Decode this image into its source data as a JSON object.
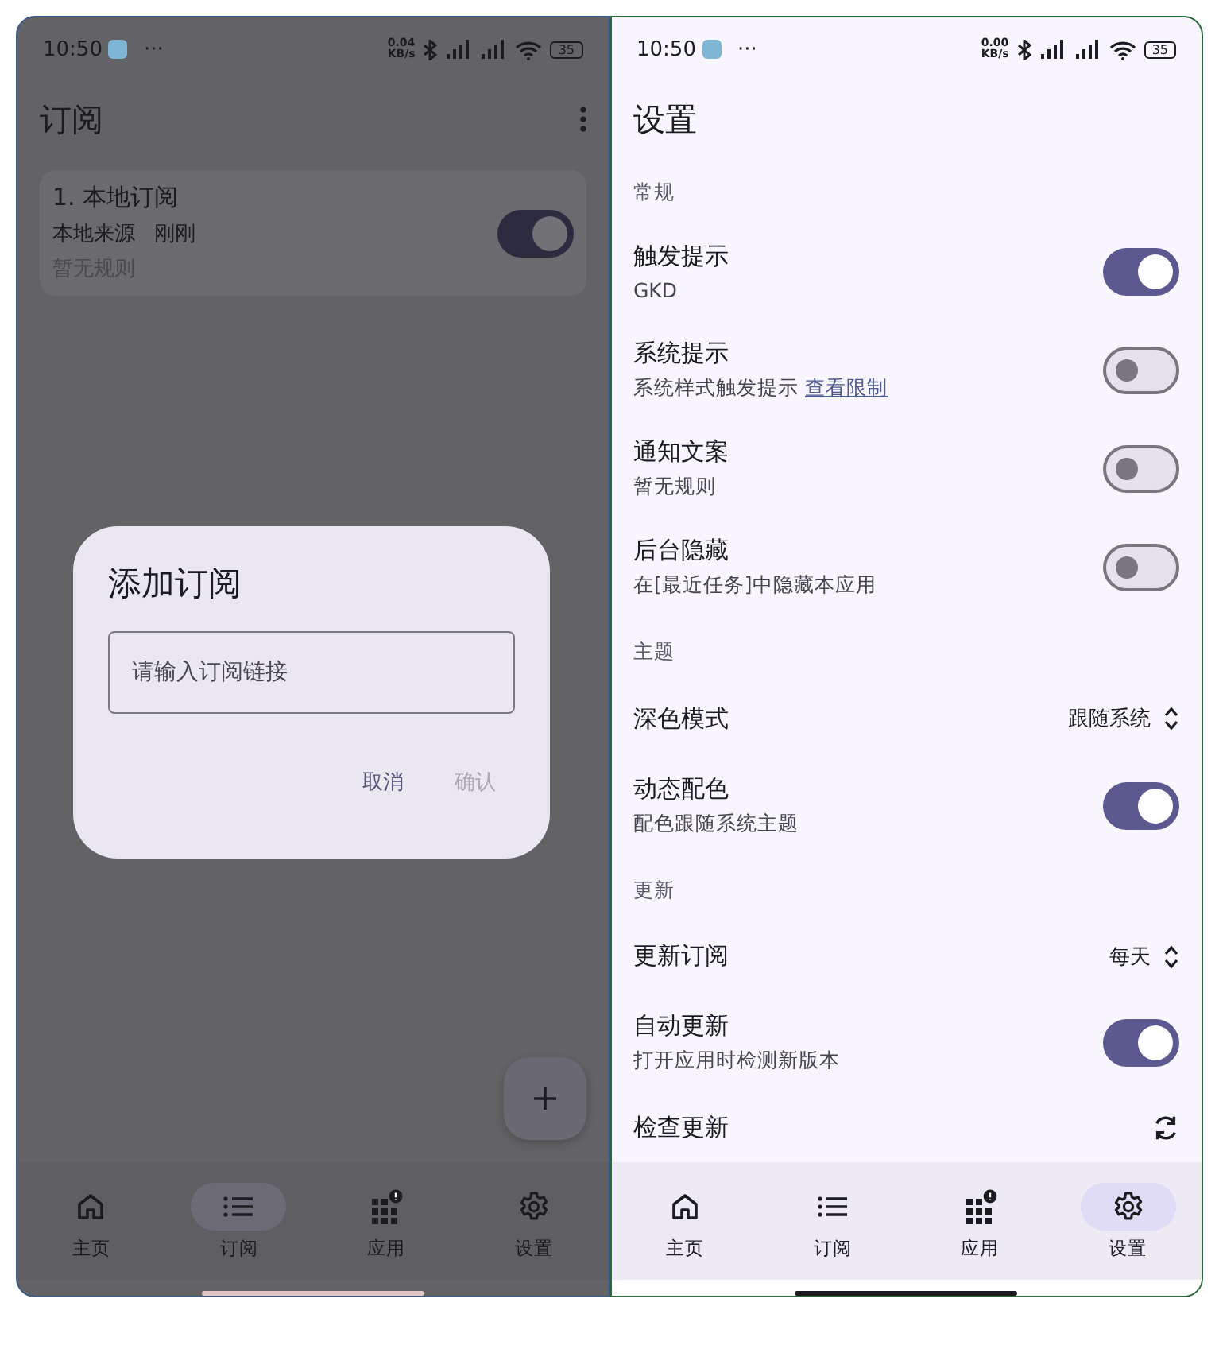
{
  "subscriptions_screen": {
    "status_bar": {
      "time": "10:50",
      "more": "···",
      "speed": [
        "0.04",
        "KB/s"
      ],
      "battery": "35"
    },
    "title": "订阅",
    "subscriptions": [
      {
        "title": "1. 本地订阅",
        "source": "本地来源",
        "time": "刚刚",
        "rules": "暂无规则",
        "on": true
      }
    ],
    "nav": [
      {
        "label": "主页",
        "selected": false
      },
      {
        "label": "订阅",
        "selected": true
      },
      {
        "label": "应用",
        "selected": false
      },
      {
        "label": "设置",
        "selected": false
      }
    ],
    "dialog": {
      "title": "添加订阅",
      "input": {
        "placeholder": "请输入订阅链接"
      },
      "buttons": [
        {
          "label": "取消",
          "disabled": false
        },
        {
          "label": "确认",
          "disabled": true
        }
      ]
    }
  },
  "settings_screen": {
    "status_bar": {
      "time": "10:50",
      "more": "···",
      "speed": [
        "0.00",
        "KB/s"
      ],
      "battery": "35"
    },
    "title": "设置",
    "items": [
      {
        "kind": "section",
        "title": "常规"
      },
      {
        "kind": "switch",
        "title": "触发提示",
        "desc": "GKD",
        "on": true
      },
      {
        "kind": "switch",
        "title": "系统提示",
        "desc": "系统样式触发提示",
        "link": "查看限制",
        "on": false
      },
      {
        "kind": "switch",
        "title": "通知文案",
        "desc": "暂无规则",
        "on": false
      },
      {
        "kind": "switch",
        "title": "后台隐藏",
        "desc": "在[最近任务]中隐藏本应用",
        "on": false
      },
      {
        "kind": "section",
        "title": "主题"
      },
      {
        "kind": "select",
        "title": "深色模式",
        "value": "跟随系统"
      },
      {
        "kind": "switch",
        "title": "动态配色",
        "desc": "配色跟随系统主题",
        "on": true
      },
      {
        "kind": "section",
        "title": "更新"
      },
      {
        "kind": "select",
        "title": "更新订阅",
        "value": "每天"
      },
      {
        "kind": "switch",
        "title": "自动更新",
        "desc": "打开应用时检测新版本",
        "on": true
      },
      {
        "kind": "action",
        "title": "检查更新"
      }
    ],
    "nav": [
      {
        "label": "主页",
        "selected": false
      },
      {
        "label": "订阅",
        "selected": false
      },
      {
        "label": "应用",
        "selected": false
      },
      {
        "label": "设置",
        "selected": true
      }
    ]
  }
}
